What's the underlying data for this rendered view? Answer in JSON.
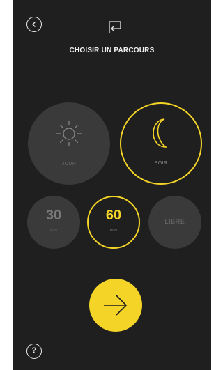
{
  "header": {
    "back_icon": "chevron-left-icon",
    "top_icon": "return-arrow-icon",
    "title": "CHOISIR UN PARCOURS"
  },
  "time_of_day": {
    "options": [
      {
        "label": "JOUR",
        "icon": "sun-icon",
        "selected": false
      },
      {
        "label": "SOIR",
        "icon": "moon-icon",
        "selected": true
      }
    ]
  },
  "duration": {
    "options": [
      {
        "value": "30",
        "unit": "MIN",
        "selected": false
      },
      {
        "value": "60",
        "unit": "MIN",
        "selected": true
      },
      {
        "label": "LIBRE",
        "selected": false
      }
    ]
  },
  "actions": {
    "go_icon": "arrow-right-icon",
    "help_label": "?"
  },
  "colors": {
    "background": "#1f1f1f",
    "accent": "#f5d428",
    "inactive": "#3a3a3a"
  }
}
